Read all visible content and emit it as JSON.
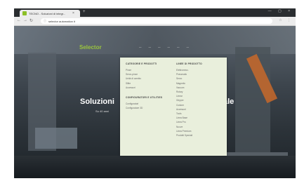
{
  "browser": {
    "tab_title": "TECNO - Soluzioni di integr...",
    "tab_close": "×",
    "new_tab": "+",
    "url": "selector automation it",
    "window_controls": "— ▢ ×"
  },
  "site": {
    "logo": "Selector",
    "menu": [
      "—",
      "—",
      "—",
      "—",
      "—",
      "—"
    ],
    "hero_title_left": "Soluzioni",
    "hero_title_right": "ale",
    "hero_subtitle": "Su 40 anni"
  },
  "dropdown": {
    "col1_heading": "CATEGORIE E PRODOTTI",
    "col1_items": [
      "Pinze",
      "Servo-pinze",
      "Unità di cambio",
      "Slitte",
      "Accessori"
    ],
    "col1_heading2": "CONFIGURATORI E UTILITIES",
    "col1_items2": [
      "Configuratori",
      "Configuratore 3D"
    ],
    "col2_heading": "LINEE DI PRODOTTO",
    "col2_items": [
      "Elettromecc.",
      "Pneumatic",
      "Servo",
      "Magnetic",
      "Vacuum",
      "Rotary",
      "Linear",
      "Gripper",
      "Custom",
      "Accessori",
      "Tools",
      "Linea Base",
      "Linea Pro",
      "Nuove",
      "Linea Premium",
      "Prodotti Speciali"
    ]
  },
  "colors": {
    "brand_green": "#9bc53d",
    "dropdown_bg": "#e9efdc"
  }
}
